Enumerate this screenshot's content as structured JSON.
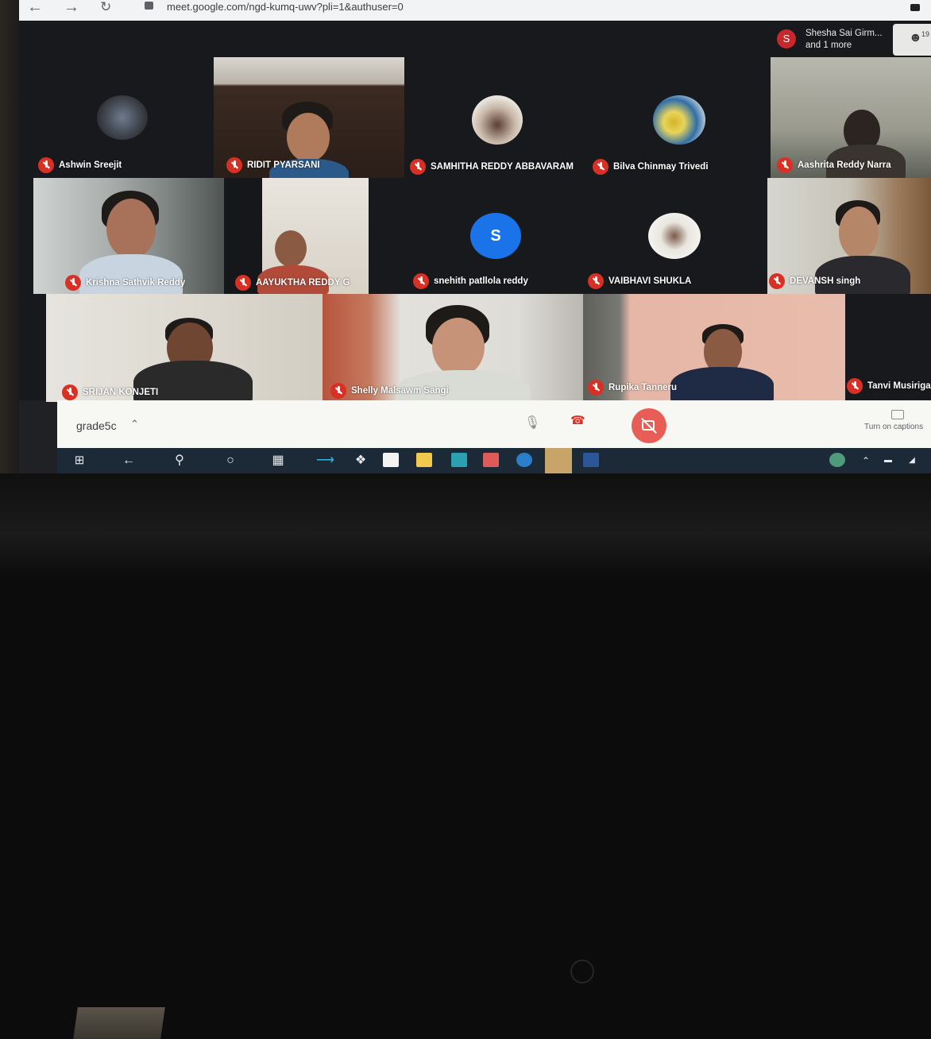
{
  "browser": {
    "url": "meet.google.com/ngd-kumq-uwv?pli=1&authuser=0",
    "back_icon": "back-arrow-icon",
    "forward_icon": "forward-arrow-icon",
    "reload_icon": "reload-icon"
  },
  "presenting": {
    "avatar_letter": "S",
    "name": "Shesha Sai Girm...",
    "sub": "and 1 more",
    "people_count": "19"
  },
  "participants": [
    {
      "name": "Ashwin Sreejit"
    },
    {
      "name": "RIDIT PYARSANI"
    },
    {
      "name": "SAMHITHA REDDY ABBAVARAM"
    },
    {
      "name": "Bilva Chinmay Trivedi"
    },
    {
      "name": "Aashrita Reddy Narra"
    },
    {
      "name": "Krishna Sathvik Reddy"
    },
    {
      "name": "AAYUKTHA REDDY G"
    },
    {
      "name": "snehith patllola reddy",
      "avatar_letter": "S"
    },
    {
      "name": "VAIBHAVI SHUKLA"
    },
    {
      "name": "DEVANSH singh"
    },
    {
      "name": "SRIJAN KONJETI"
    },
    {
      "name": "Shelly Malsawm Sangi"
    },
    {
      "name": "Rupika Tanneru"
    },
    {
      "name": "Tanvi Musiriga"
    }
  ],
  "controls": {
    "meeting_code": "grade5c",
    "captions_label": "Turn on captions"
  },
  "colors": {
    "mute_red": "#d93025",
    "meet_bg": "#17191c",
    "avatar_blue": "#1a73e8"
  }
}
